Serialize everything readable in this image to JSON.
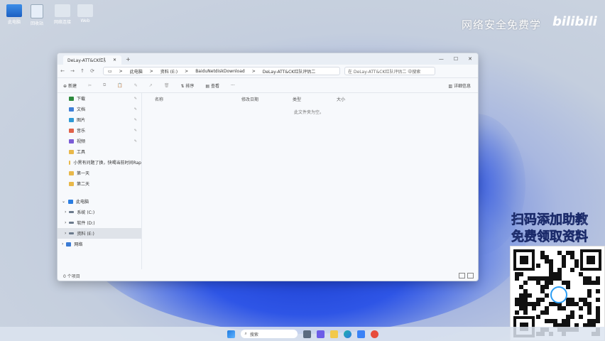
{
  "desktop": {
    "icons": [
      {
        "label": "此电脑",
        "icon": "monitor-icon"
      },
      {
        "label": "回收站",
        "icon": "recycle-bin-icon"
      },
      {
        "label": "网络连接",
        "icon": "folder-icon"
      },
      {
        "label": "Web",
        "icon": "folder-icon"
      }
    ],
    "brand_text": "网络安全免费学",
    "brand_logo": "bilibili",
    "promo_line1": "扫码添加助教",
    "promo_line2": "免费领取资料"
  },
  "window": {
    "tab_title": "DeLay-ATT&CK红队评估二",
    "tab_close": "✕",
    "new_tab": "+",
    "controls": {
      "minimize": "—",
      "maximize": "☐",
      "close": "✕"
    },
    "nav": {
      "back": "←",
      "forward": "→",
      "up": "↑",
      "refresh": "⟳",
      "monitor": "▭"
    },
    "breadcrumb": [
      "此电脑",
      "资料 (E:)",
      "BaiduNetdiskDownload",
      "DeLay-ATT&CK红队评估二"
    ],
    "breadcrumb_sep": ">",
    "search_placeholder": "在 DeLay-ATT&CK红队评估二 中搜索",
    "toolbar": {
      "new": "新建",
      "cut": "✂",
      "copy": "⧉",
      "paste": "📋",
      "rename": "✎",
      "share": "↗",
      "delete": "🗑",
      "sort": "排序",
      "view": "查看",
      "more": "···",
      "details": "详细信息"
    },
    "sidebar": {
      "quick_access": [
        {
          "label": "下载",
          "icon": "download-icon",
          "pinned": true
        },
        {
          "label": "文档",
          "icon": "document-icon",
          "pinned": true
        },
        {
          "label": "图片",
          "icon": "picture-icon",
          "pinned": true
        },
        {
          "label": "音乐",
          "icon": "music-icon",
          "pinned": true
        },
        {
          "label": "视频",
          "icon": "video-icon",
          "pinned": true
        },
        {
          "label": "工具",
          "icon": "folder-icon",
          "pinned": false
        },
        {
          "label": "小黑有问题了换，快喝当前时间Rap",
          "icon": "folder-icon",
          "pinned": false
        },
        {
          "label": "第一天",
          "icon": "folder-icon",
          "pinned": false
        },
        {
          "label": "第二天",
          "icon": "folder-icon",
          "pinned": false
        }
      ],
      "this_pc": "此电脑",
      "drives": [
        {
          "label": "系统 (C:)",
          "icon": "drive-icon"
        },
        {
          "label": "软件 (D:)",
          "icon": "drive-icon"
        },
        {
          "label": "资料 (E:)",
          "icon": "drive-icon",
          "selected": true
        }
      ],
      "network": "网络"
    },
    "columns": [
      "名称",
      "修改日期",
      "类型",
      "大小"
    ],
    "empty_message": "此文件夹为空。",
    "status": "0 个项目"
  },
  "taskbar": {
    "search_label": "搜索",
    "icons": [
      "start-icon",
      "search-icon",
      "taskview-icon",
      "chat-icon",
      "explorer-icon",
      "edge-icon",
      "store-icon",
      "app-icon"
    ]
  },
  "colors": {
    "accent": "#2e55e6",
    "window_bg": "#f7f9fc",
    "selected_row": "#dfe3e9"
  }
}
